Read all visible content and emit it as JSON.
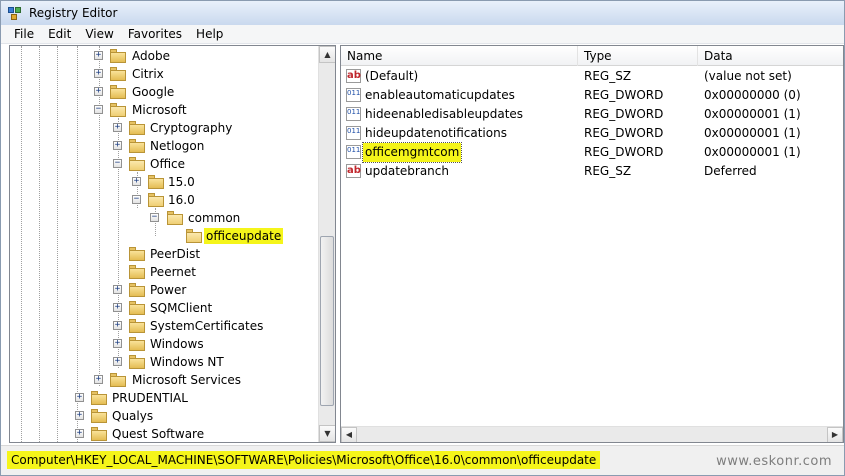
{
  "window": {
    "title": "Registry Editor"
  },
  "menu": [
    "File",
    "Edit",
    "View",
    "Favorites",
    "Help"
  ],
  "tree": {
    "nodes": [
      {
        "label": "Adobe",
        "expander": "+"
      },
      {
        "label": "Citrix",
        "expander": "+"
      },
      {
        "label": "Google",
        "expander": "+"
      },
      {
        "label": "Microsoft",
        "expander": "−"
      },
      {
        "label": "Cryptography",
        "expander": "+"
      },
      {
        "label": "Netlogon",
        "expander": "+"
      },
      {
        "label": "Office",
        "expander": "−"
      },
      {
        "label": "15.0",
        "expander": "+"
      },
      {
        "label": "16.0",
        "expander": "−"
      },
      {
        "label": "common",
        "expander": "−"
      },
      {
        "label": "officeupdate",
        "expander": ""
      },
      {
        "label": "PeerDist",
        "expander": ""
      },
      {
        "label": "Peernet",
        "expander": ""
      },
      {
        "label": "Power",
        "expander": "+"
      },
      {
        "label": "SQMClient",
        "expander": "+"
      },
      {
        "label": "SystemCertificates",
        "expander": "+"
      },
      {
        "label": "Windows",
        "expander": "+"
      },
      {
        "label": "Windows NT",
        "expander": "+"
      },
      {
        "label": "Microsoft Services",
        "expander": "+"
      },
      {
        "label": "PRUDENTIAL",
        "expander": "+"
      },
      {
        "label": "Qualys",
        "expander": "+"
      },
      {
        "label": "Quest Software",
        "expander": "+"
      }
    ],
    "scroll_up": "▲",
    "scroll_down": "▼"
  },
  "list": {
    "columns": {
      "name": "Name",
      "type": "Type",
      "data": "Data"
    },
    "rows": [
      {
        "name": "(Default)",
        "type": "REG_SZ",
        "data": "(value not set)",
        "icon": "ab"
      },
      {
        "name": "enableautomaticupdates",
        "type": "REG_DWORD",
        "data": "0x00000000 (0)",
        "icon": "011"
      },
      {
        "name": "hideenabledisableupdates",
        "type": "REG_DWORD",
        "data": "0x00000001 (1)",
        "icon": "011"
      },
      {
        "name": "hideupdatenotifications",
        "type": "REG_DWORD",
        "data": "0x00000001 (1)",
        "icon": "011"
      },
      {
        "name": "officemgmtcom",
        "type": "REG_DWORD",
        "data": "0x00000001 (1)",
        "icon": "011"
      },
      {
        "name": "updatebranch",
        "type": "REG_SZ",
        "data": "Deferred",
        "icon": "ab"
      }
    ],
    "scroll_left": "◀",
    "scroll_right": "▶"
  },
  "status": {
    "path": "Computer\\HKEY_LOCAL_MACHINE\\SOFTWARE\\Policies\\Microsoft\\Office\\16.0\\common\\officeupdate"
  },
  "watermark": "www.eskonr.com",
  "colors": {
    "highlight": "#f5f51a",
    "folder": "#e4bd53"
  }
}
